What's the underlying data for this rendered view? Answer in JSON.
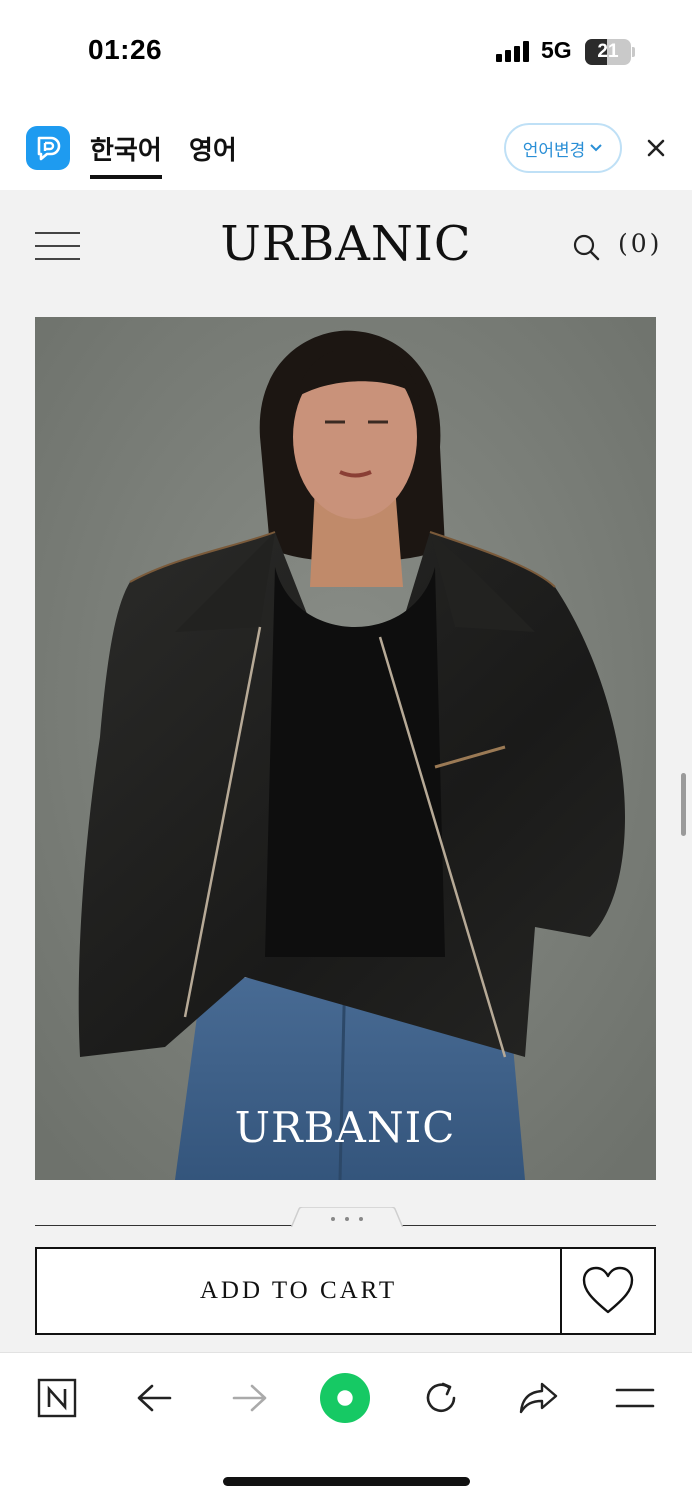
{
  "status_bar": {
    "time": "01:26",
    "network": "5G",
    "battery_level": "21"
  },
  "translate_bar": {
    "tabs": [
      {
        "label": "한국어",
        "active": true
      },
      {
        "label": "영어",
        "active": false
      }
    ],
    "change_language_label": "언어변경",
    "accent_color": "#1e9bf0"
  },
  "site": {
    "logo": "URBANIC",
    "cart_count": "(0)",
    "hero_logo": "URBANIC",
    "add_to_cart_label": "ADD TO CART"
  },
  "browser_toolbar": {
    "icons": [
      "naver-home-icon",
      "back-arrow-icon",
      "forward-arrow-icon",
      "green-dot-icon",
      "reload-icon",
      "share-icon",
      "menu-icon"
    ],
    "brand_color": "#16c964"
  }
}
